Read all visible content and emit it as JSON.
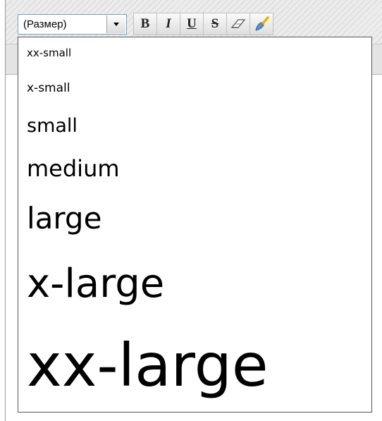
{
  "toolbar": {
    "size_select_value": "(Размер)",
    "buttons": [
      {
        "label": "B",
        "icon": "bold-icon"
      },
      {
        "label": "I",
        "icon": "italic-icon"
      },
      {
        "label": "U",
        "icon": "underline-icon"
      },
      {
        "label": "S",
        "icon": "strikethrough-icon"
      },
      {
        "label": "",
        "icon": "eraser-icon"
      },
      {
        "label": "",
        "icon": "format-brush-icon"
      }
    ]
  },
  "size_dropdown": {
    "options": [
      "xx-small",
      "x-small",
      "small",
      "medium",
      "large",
      "x-large",
      "xx-large"
    ]
  },
  "colors": {
    "select_border": "#7f9db9",
    "dropdown_border": "#555555",
    "toolbar_bg": "#ececec",
    "brush_handle": "#e8b400",
    "brush_bristles": "#5a8fcf"
  }
}
